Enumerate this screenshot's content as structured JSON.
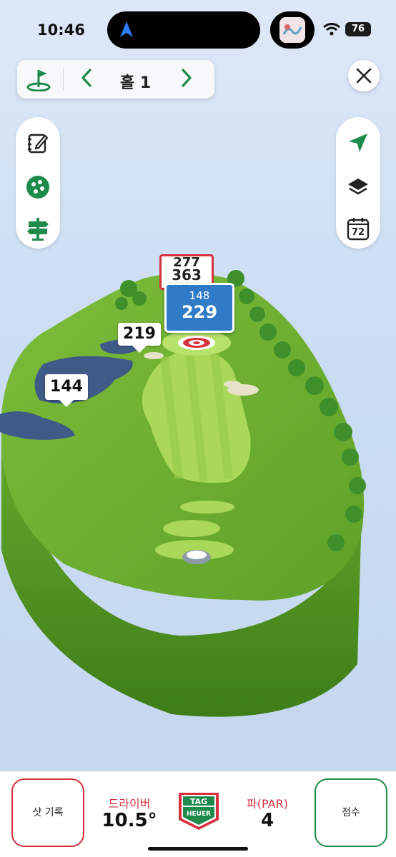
{
  "status_bar": {
    "time": "10:46",
    "battery": "76"
  },
  "hole_nav": {
    "label": "홀 1",
    "prev_icon": "chevron-left-icon",
    "next_icon": "chevron-right-icon"
  },
  "markers": {
    "red_top": "277",
    "red_main": "363",
    "blue_sub": "148",
    "blue_main": "229",
    "left_mid": "219",
    "left_low": "144"
  },
  "right_toolbar": {
    "calendar_number": "72"
  },
  "bottom_bar": {
    "shot_label": "샷 기록",
    "driver_label": "드라이버",
    "driver_value": "10.5°",
    "par_label": "파(PAR)",
    "par_value": "4",
    "score_label": "점수"
  },
  "colors": {
    "accent_red": "#d6303d",
    "accent_green": "#1e8a4c",
    "marker_blue": "#2f7bc7"
  }
}
